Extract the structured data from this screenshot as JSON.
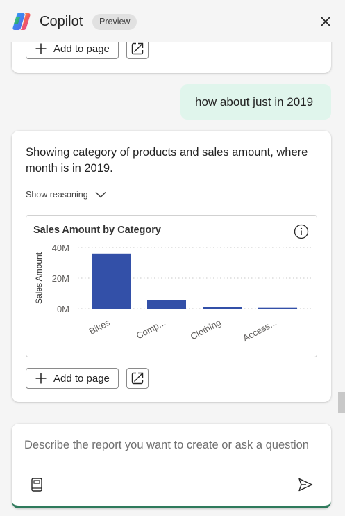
{
  "header": {
    "title": "Copilot",
    "badge": "Preview",
    "close_icon": "close-icon",
    "logo_icon": "copilot-logo"
  },
  "top_card": {
    "add_label": "Add to page",
    "expand_icon": "open-in-new-icon"
  },
  "user_message": "how about just in 2019",
  "answer": {
    "text": "Showing category of products and sales amount, where month is in 2019.",
    "reasoning_label": "Show reasoning",
    "add_label": "Add to page",
    "expand_icon": "open-in-new-icon"
  },
  "chart_data": {
    "type": "bar",
    "title": "Sales Amount by Category",
    "xlabel": "",
    "ylabel": "Sales Amount",
    "categories": [
      "Bikes",
      "Comp...",
      "Clothing",
      "Access..."
    ],
    "values": [
      36000000,
      5600000,
      1100000,
      600000
    ],
    "ylim": [
      0,
      40000000
    ],
    "yticks": [
      0,
      20000000,
      40000000
    ],
    "ytick_labels": [
      "0M",
      "20M",
      "40M"
    ],
    "bar_color": "#3350a8",
    "grid": true
  },
  "composer": {
    "placeholder": "Describe the report you want to create or ask a question",
    "accent_color": "#2f7a5c",
    "left_icon": "prompt-guide-icon",
    "send_icon": "send-icon"
  }
}
